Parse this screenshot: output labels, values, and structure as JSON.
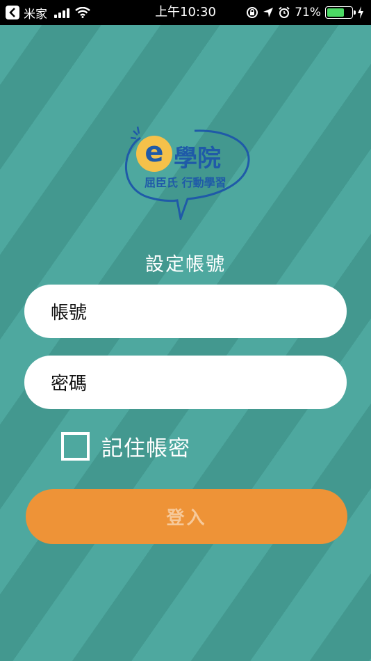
{
  "status_bar": {
    "carrier": "米家",
    "time": "上午10:30",
    "battery_percent": "71%",
    "battery_level": 0.71,
    "battery_color": "#4cd964",
    "icons": [
      "back-icon",
      "signal-icon",
      "wifi-icon",
      "orientation-lock-icon",
      "location-icon",
      "alarm-icon",
      "battery-icon",
      "charging-icon"
    ]
  },
  "logo": {
    "brand_name": "學院",
    "brand_letter": "e",
    "tagline": "屈臣氏 行動學習",
    "letter_color": "#f5c14a",
    "outline_color": "#1f5aa8"
  },
  "form": {
    "title": "設定帳號",
    "account_placeholder": "帳號",
    "password_placeholder": "密碼",
    "remember_label": "記住帳密",
    "remember_checked": false,
    "login_label": "登入"
  },
  "colors": {
    "background": "#4aa39b",
    "button": "#ee9337",
    "button_text": "#f6c99a"
  }
}
